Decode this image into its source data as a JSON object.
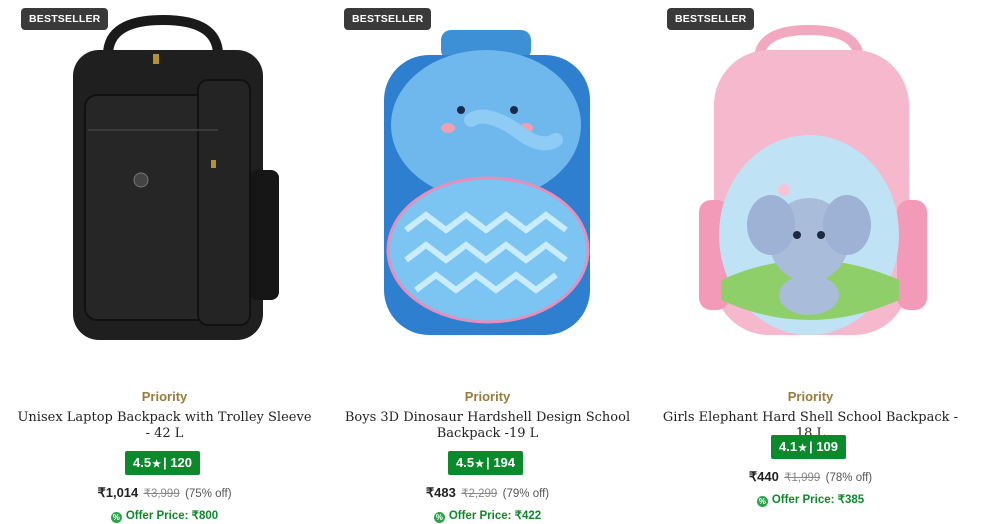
{
  "products": [
    {
      "badge": "BESTSELLER",
      "brand": "Priority",
      "title": "Unisex Laptop Backpack with Trolley Sleeve - 42 L",
      "rating": "4.5",
      "reviews": "120",
      "rating_sep": "|",
      "price": "₹1,014",
      "mrp": "₹3,999",
      "discount": "(75% off)",
      "offer_label": "Offer Price:",
      "offer_price": "₹800",
      "image": "black-laptop-backpack"
    },
    {
      "badge": "BESTSELLER",
      "brand": "Priority",
      "title": "Boys 3D Dinosaur Hardshell Design School Backpack -19 L",
      "rating": "4.5",
      "reviews": "194",
      "rating_sep": "|",
      "price": "₹483",
      "mrp": "₹2,299",
      "discount": "(79% off)",
      "offer_label": "Offer Price:",
      "offer_price": "₹422",
      "image": "blue-elephant-hardshell-backpack"
    },
    {
      "badge": "BESTSELLER",
      "brand": "Priority",
      "title": "Girls Elephant Hard Shell School Backpack - 18 L",
      "rating": "4.1",
      "reviews": "109",
      "rating_sep": "|",
      "price": "₹440",
      "mrp": "₹1,999",
      "discount": "(78% off)",
      "offer_label": "Offer Price:",
      "offer_price": "₹385",
      "image": "pink-elephant-backpack"
    }
  ],
  "icons": {
    "star": "★",
    "offer": "%"
  },
  "colors": {
    "rating_bg": "#0b8a2c",
    "brand": "#9a7b3a",
    "offer": "#0b8a2c",
    "badge_bg": "#3a3a3a"
  }
}
